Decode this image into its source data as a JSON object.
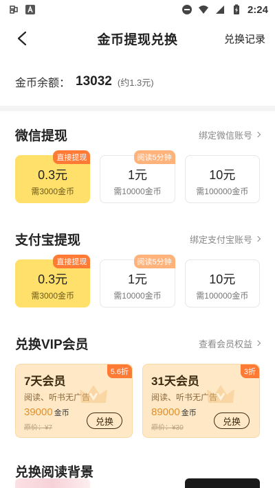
{
  "statusbar": {
    "time": "2:24",
    "left_icons": [
      "notification-icon",
      "app-a-icon"
    ],
    "right_icons": [
      "dnd-icon",
      "wifi-icon",
      "signal-icon",
      "battery-icon"
    ]
  },
  "nav": {
    "title": "金币提现兑换",
    "right_link": "兑换记录"
  },
  "balance": {
    "label": "金币余额：",
    "value": "13032",
    "approx": "(约1.3元)"
  },
  "wechat": {
    "title": "微信提现",
    "link": "绑定微信账号",
    "cards": [
      {
        "amount": "0.3元",
        "need": "需3000金币",
        "tag": "直接提现",
        "active": true
      },
      {
        "amount": "1元",
        "need": "需10000金币",
        "tag": "阅读5分钟",
        "active": false
      },
      {
        "amount": "10元",
        "need": "需100000金币",
        "tag": "",
        "active": false
      }
    ]
  },
  "alipay": {
    "title": "支付宝提现",
    "link": "绑定支付宝账号",
    "cards": [
      {
        "amount": "0.3元",
        "need": "需3000金币",
        "tag": "直接提现",
        "active": true
      },
      {
        "amount": "1元",
        "need": "需10000金币",
        "tag": "阅读5分钟",
        "active": false
      },
      {
        "amount": "10元",
        "need": "需100000金币",
        "tag": "",
        "active": false
      }
    ]
  },
  "vip": {
    "title": "兑换VIP会员",
    "link": "查看会员权益",
    "cards": [
      {
        "name": "7天会员",
        "desc": "阅读、听书无广告",
        "price": "39000",
        "unit": "金币",
        "orig": "原价：¥7",
        "button": "兑换",
        "tag": "5.6折"
      },
      {
        "name": "31天会员",
        "desc": "阅读、听书无广告",
        "price": "89000",
        "unit": "金币",
        "orig": "原价：¥30",
        "button": "兑换",
        "tag": "3折"
      }
    ]
  },
  "backgrounds": {
    "title": "兑换阅读背景"
  },
  "colors": {
    "accent_yellow": "#ffe06a",
    "tag_orange": "#ff7a35",
    "vip_bg": "#ffe8c6",
    "price_orange": "#e2902a"
  }
}
